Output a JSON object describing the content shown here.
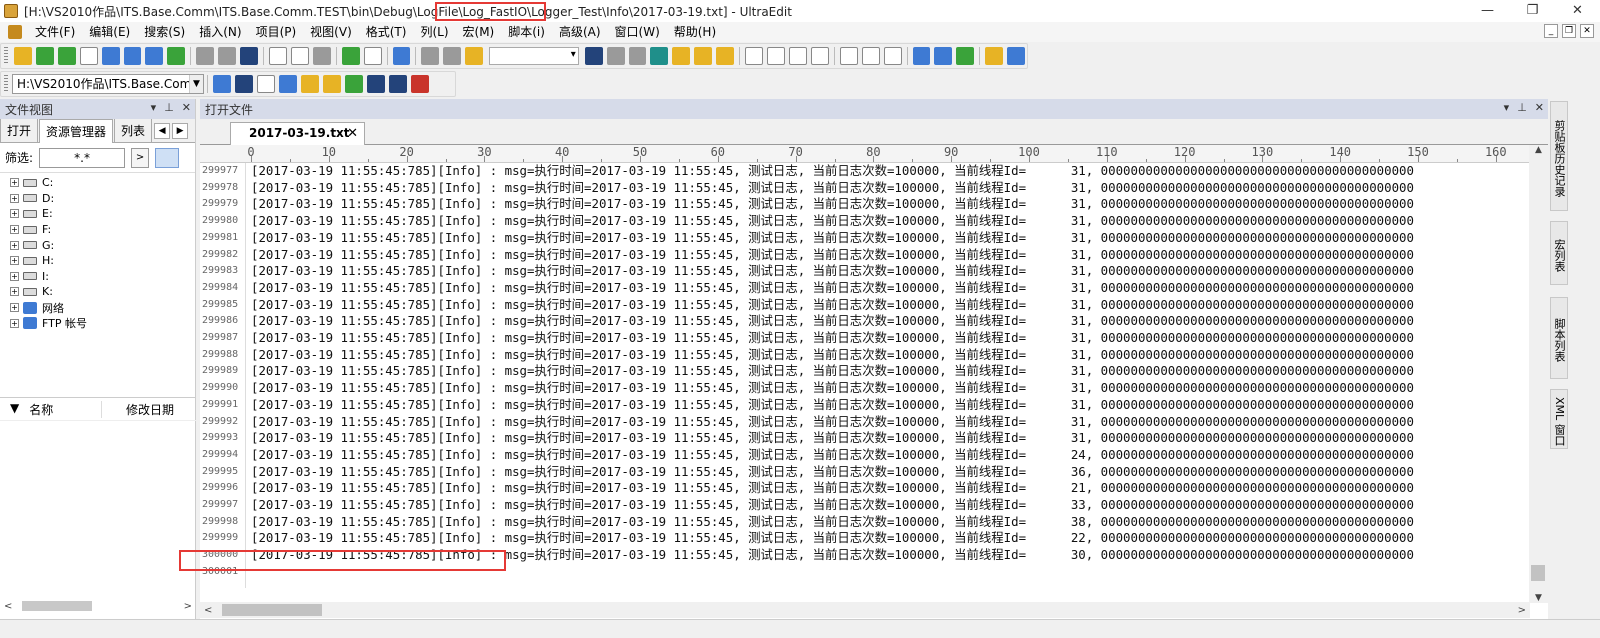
{
  "window": {
    "title": "[H:\\VS2010作品\\ITS.Base.Comm\\ITS.Base.Comm.TEST\\bin\\Debug\\LogFile\\Log_FastIO\\Logger_Test\\Info\\2017-03-19.txt] - UltraEdit",
    "controls": {
      "minimize": "—",
      "restore": "❐",
      "close": "✕"
    }
  },
  "menu": [
    "文件(F)",
    "编辑(E)",
    "搜索(S)",
    "插入(N)",
    "项目(P)",
    "视图(V)",
    "格式(T)",
    "列(L)",
    "宏(M)",
    "脚本(i)",
    "高级(A)",
    "窗口(W)",
    "帮助(H)"
  ],
  "toolbar2": {
    "path": "H:\\VS2010作品\\ITS.Base.Comm"
  },
  "file_view": {
    "title": "文件视图",
    "tabs": [
      "打开",
      "资源管理器",
      "列表"
    ],
    "filter_label": "筛选:",
    "filter_value": "*.*",
    "tree": [
      "C:",
      "D:",
      "E:",
      "F:",
      "G:",
      "H:",
      "I:",
      "K:",
      "网络",
      "FTP 帐号"
    ],
    "columns": [
      "名称",
      "修改日期"
    ]
  },
  "editor": {
    "panel_title": "打开文件",
    "tab": "2017-03-19.txt",
    "ruler_labels": [
      "0",
      "10",
      "20",
      "30",
      "40",
      "50",
      "60",
      "70",
      "80",
      "90",
      "100",
      "110",
      "120",
      "130",
      "140",
      "150",
      "160"
    ],
    "line_numbers": [
      "299977",
      "299978",
      "299979",
      "299980",
      "299981",
      "299982",
      "299983",
      "299984",
      "299985",
      "299986",
      "299987",
      "299988",
      "299989",
      "299990",
      "299991",
      "299992",
      "299993",
      "299994",
      "299995",
      "299996",
      "299997",
      "299998",
      "299999",
      "300000",
      "300001"
    ],
    "lines": [
      "[2017-03-19 11:55:45:785][Info] : msg=执行时间=2017-03-19 11:55:45, 测试日志, 当前日志次数=100000, 当前线程Id=      31, 000000000000000000000000000000000000000000",
      "[2017-03-19 11:55:45:785][Info] : msg=执行时间=2017-03-19 11:55:45, 测试日志, 当前日志次数=100000, 当前线程Id=      31, 000000000000000000000000000000000000000000",
      "[2017-03-19 11:55:45:785][Info] : msg=执行时间=2017-03-19 11:55:45, 测试日志, 当前日志次数=100000, 当前线程Id=      31, 000000000000000000000000000000000000000000",
      "[2017-03-19 11:55:45:785][Info] : msg=执行时间=2017-03-19 11:55:45, 测试日志, 当前日志次数=100000, 当前线程Id=      31, 000000000000000000000000000000000000000000",
      "[2017-03-19 11:55:45:785][Info] : msg=执行时间=2017-03-19 11:55:45, 测试日志, 当前日志次数=100000, 当前线程Id=      31, 000000000000000000000000000000000000000000",
      "[2017-03-19 11:55:45:785][Info] : msg=执行时间=2017-03-19 11:55:45, 测试日志, 当前日志次数=100000, 当前线程Id=      31, 000000000000000000000000000000000000000000",
      "[2017-03-19 11:55:45:785][Info] : msg=执行时间=2017-03-19 11:55:45, 测试日志, 当前日志次数=100000, 当前线程Id=      31, 000000000000000000000000000000000000000000",
      "[2017-03-19 11:55:45:785][Info] : msg=执行时间=2017-03-19 11:55:45, 测试日志, 当前日志次数=100000, 当前线程Id=      31, 000000000000000000000000000000000000000000",
      "[2017-03-19 11:55:45:785][Info] : msg=执行时间=2017-03-19 11:55:45, 测试日志, 当前日志次数=100000, 当前线程Id=      31, 000000000000000000000000000000000000000000",
      "[2017-03-19 11:55:45:785][Info] : msg=执行时间=2017-03-19 11:55:45, 测试日志, 当前日志次数=100000, 当前线程Id=      31, 000000000000000000000000000000000000000000",
      "[2017-03-19 11:55:45:785][Info] : msg=执行时间=2017-03-19 11:55:45, 测试日志, 当前日志次数=100000, 当前线程Id=      31, 000000000000000000000000000000000000000000",
      "[2017-03-19 11:55:45:785][Info] : msg=执行时间=2017-03-19 11:55:45, 测试日志, 当前日志次数=100000, 当前线程Id=      31, 000000000000000000000000000000000000000000",
      "[2017-03-19 11:55:45:785][Info] : msg=执行时间=2017-03-19 11:55:45, 测试日志, 当前日志次数=100000, 当前线程Id=      31, 000000000000000000000000000000000000000000",
      "[2017-03-19 11:55:45:785][Info] : msg=执行时间=2017-03-19 11:55:45, 测试日志, 当前日志次数=100000, 当前线程Id=      31, 000000000000000000000000000000000000000000",
      "[2017-03-19 11:55:45:785][Info] : msg=执行时间=2017-03-19 11:55:45, 测试日志, 当前日志次数=100000, 当前线程Id=      31, 000000000000000000000000000000000000000000",
      "[2017-03-19 11:55:45:785][Info] : msg=执行时间=2017-03-19 11:55:45, 测试日志, 当前日志次数=100000, 当前线程Id=      31, 000000000000000000000000000000000000000000",
      "[2017-03-19 11:55:45:785][Info] : msg=执行时间=2017-03-19 11:55:45, 测试日志, 当前日志次数=100000, 当前线程Id=      31, 000000000000000000000000000000000000000000",
      "[2017-03-19 11:55:45:785][Info] : msg=执行时间=2017-03-19 11:55:45, 测试日志, 当前日志次数=100000, 当前线程Id=      24, 000000000000000000000000000000000000000000",
      "[2017-03-19 11:55:45:785][Info] : msg=执行时间=2017-03-19 11:55:45, 测试日志, 当前日志次数=100000, 当前线程Id=      36, 000000000000000000000000000000000000000000",
      "[2017-03-19 11:55:45:785][Info] : msg=执行时间=2017-03-19 11:55:45, 测试日志, 当前日志次数=100000, 当前线程Id=      21, 000000000000000000000000000000000000000000",
      "[2017-03-19 11:55:45:785][Info] : msg=执行时间=2017-03-19 11:55:45, 测试日志, 当前日志次数=100000, 当前线程Id=      33, 000000000000000000000000000000000000000000",
      "[2017-03-19 11:55:45:785][Info] : msg=执行时间=2017-03-19 11:55:45, 测试日志, 当前日志次数=100000, 当前线程Id=      38, 000000000000000000000000000000000000000000",
      "[2017-03-19 11:55:45:785][Info] : msg=执行时间=2017-03-19 11:55:45, 测试日志, 当前日志次数=100000, 当前线程Id=      22, 000000000000000000000000000000000000000000",
      "[2017-03-19 11:55:45:785][Info] : msg=执行时间=2017-03-19 11:55:45, 测试日志, 当前日志次数=100000, 当前线程Id=      30, 000000000000000000000000000000000000000000",
      ""
    ]
  },
  "side_panels": [
    "剪贴板历史记录",
    "宏列表",
    "脚本列表",
    "XML 窗口"
  ],
  "colors": {
    "highlight": "#e53935",
    "panel_header": "#d6dbe9"
  }
}
